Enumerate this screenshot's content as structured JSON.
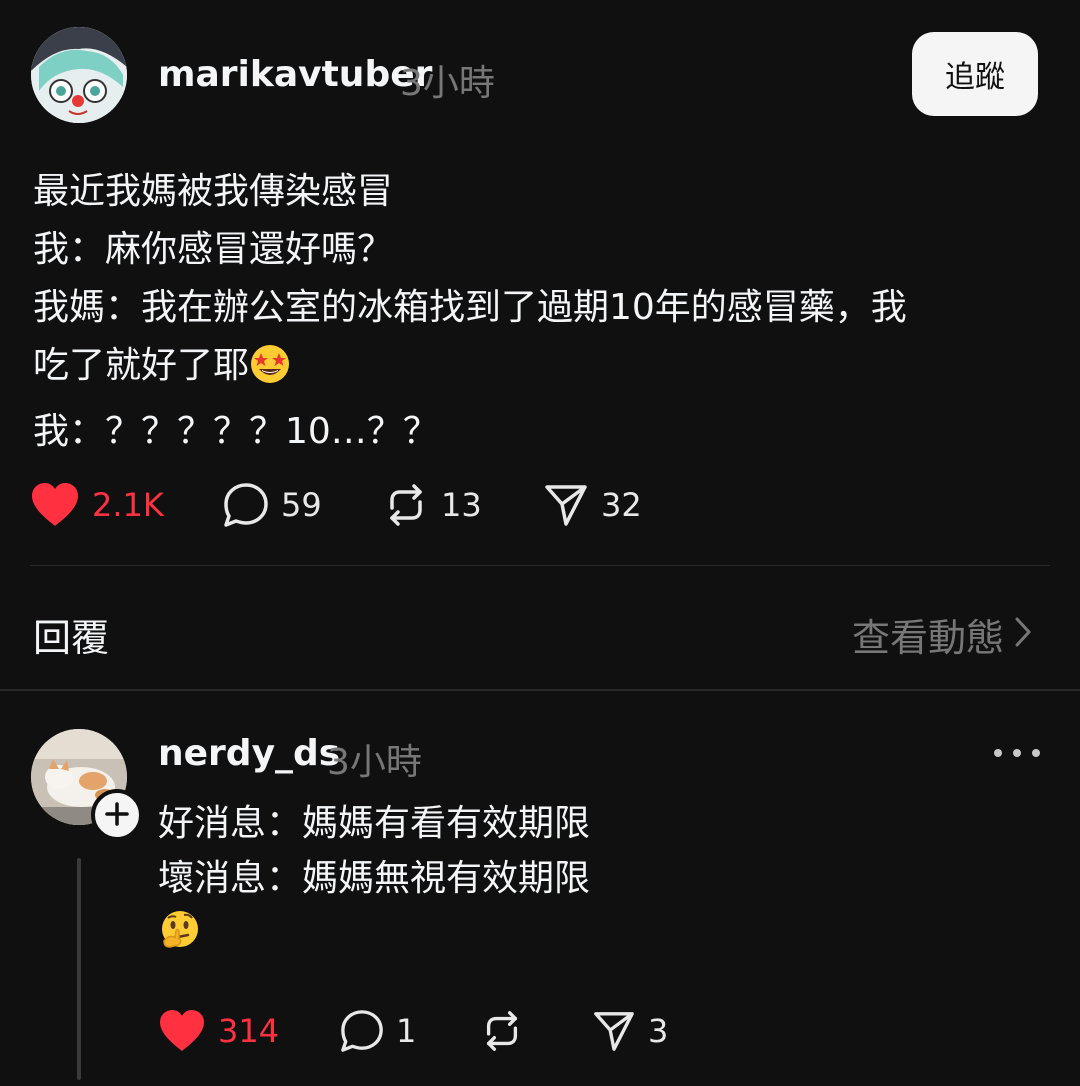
{
  "post": {
    "author": "marikavtuber",
    "time": "3小時",
    "follow_label": "追蹤",
    "lines": [
      "最近我媽被我傳染感冒",
      "我：麻你感冒還好嗎？",
      "我媽：我在辦公室的冰箱找到了過期10年的感冒藥，我",
      "吃了就好了耶",
      "我：？？？？？10…？？"
    ],
    "emoji_after_line_4": "star-struck-emoji",
    "likes": "2.1K",
    "comments": "59",
    "reposts": "13",
    "shares": "32"
  },
  "replies_section": {
    "title": "回覆",
    "view_activity": "查看動態"
  },
  "reply": {
    "author": "nerdy_ds",
    "time": "3小時",
    "lines": [
      "好消息：媽媽有看有效期限",
      "壞消息：媽媽無視有效期限"
    ],
    "emoji": "thinking-face-emoji",
    "likes": "314",
    "comments": "1",
    "shares": "3"
  },
  "colors": {
    "background": "#101010",
    "text": "#f3f5f7",
    "muted": "#777777",
    "like": "#ff3040",
    "divider": "#2a2a2a"
  }
}
